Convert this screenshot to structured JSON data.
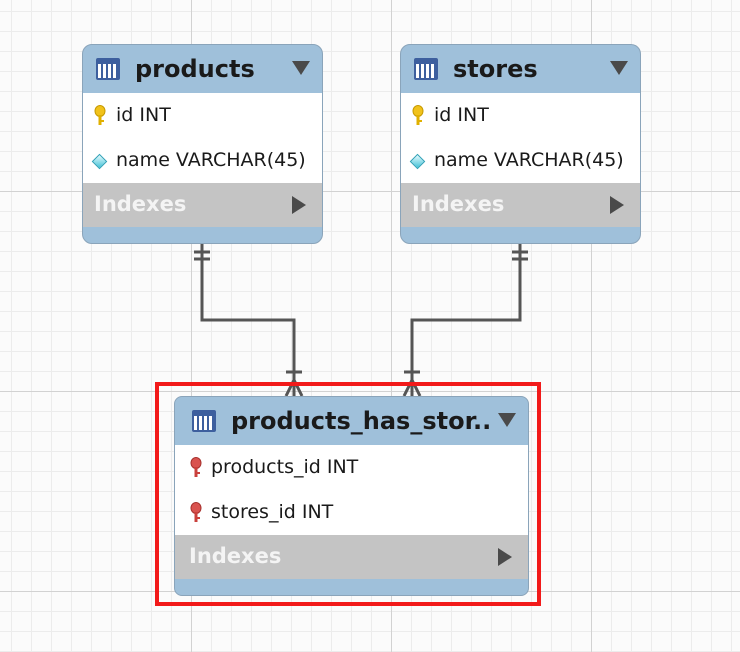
{
  "entities": {
    "products": {
      "title": "products",
      "columns": [
        {
          "label": "id INT",
          "key": "primary"
        },
        {
          "label": "name VARCHAR(45)",
          "key": "attribute"
        }
      ],
      "indexes_label": "Indexes"
    },
    "stores": {
      "title": "stores",
      "columns": [
        {
          "label": "id INT",
          "key": "primary"
        },
        {
          "label": "name VARCHAR(45)",
          "key": "attribute"
        }
      ],
      "indexes_label": "Indexes"
    },
    "products_has_stores": {
      "title": "products_has_stor...",
      "columns": [
        {
          "label": "products_id INT",
          "key": "foreign"
        },
        {
          "label": "stores_id INT",
          "key": "foreign"
        }
      ],
      "indexes_label": "Indexes"
    }
  },
  "colors": {
    "header": "#9fc0da",
    "primary_key": "#f1c21b",
    "foreign_key": "#d9534f",
    "attribute": "#43c2d6",
    "connector": "#555555",
    "selection": "#f21a1a"
  }
}
